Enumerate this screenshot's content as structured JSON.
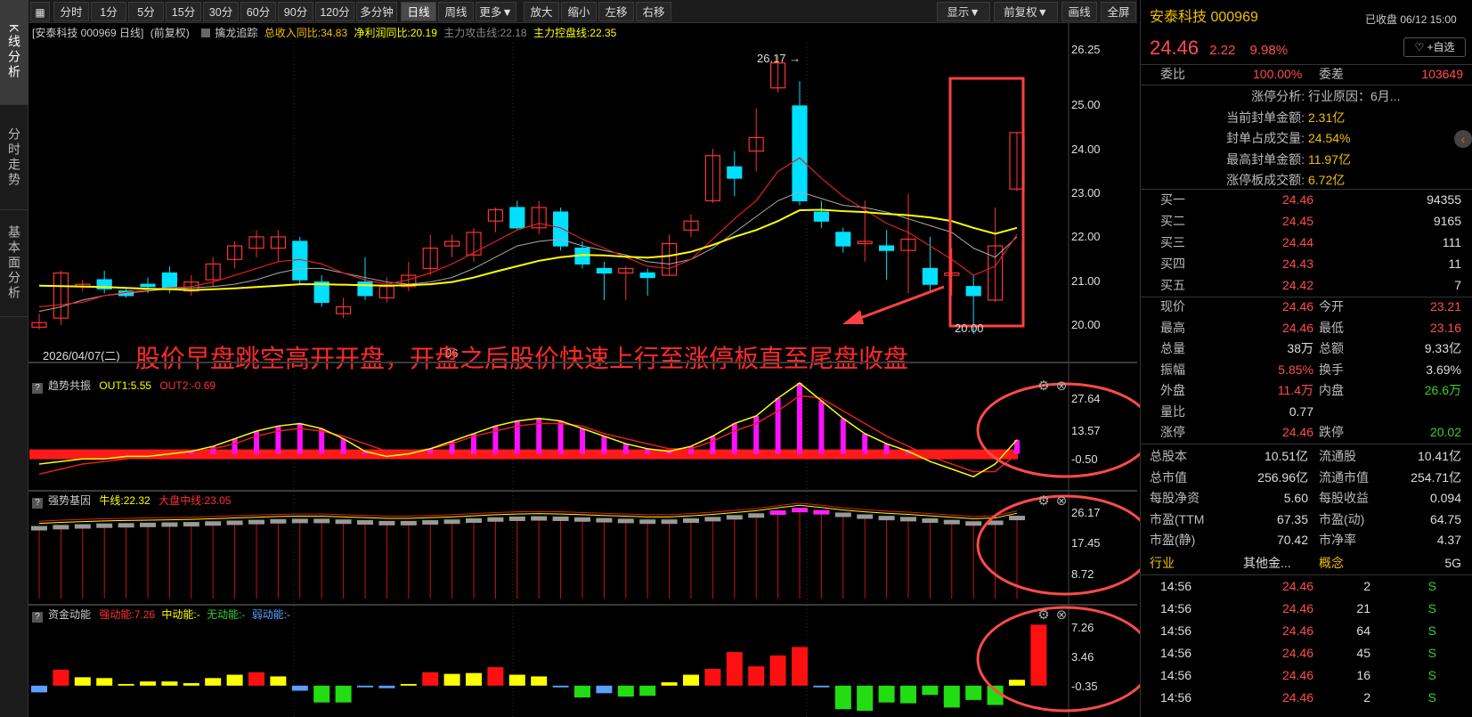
{
  "left_nav": [
    "K线分析",
    "分时走势",
    "基本面分析"
  ],
  "toolbar": {
    "periods": [
      "分时",
      "1分",
      "5分",
      "15分",
      "30分",
      "60分",
      "90分",
      "120分",
      "多分钟",
      "日线",
      "周线",
      "更多▼"
    ],
    "active_period": "日线",
    "tools": [
      "放大",
      "缩小",
      "左移",
      "右移"
    ],
    "right_tools": [
      "显示▼",
      "前复权▼",
      "画线",
      "全屏"
    ]
  },
  "infobar": {
    "stock": "[安泰科技 000969 日线]",
    "adjust": "(前复权)",
    "indicator": "擒龙追踪",
    "rev_yoy": "总收入同比:34.83",
    "profit_yoy": "净利润同比:20.19",
    "attack": "主力攻击线:22.18",
    "control": "主力控盘线:22.35"
  },
  "main_chart": {
    "axis": [
      "26.25",
      "25.00",
      "24.00",
      "23.00",
      "22.00",
      "21.00",
      "20.00"
    ],
    "high_label": "26.17",
    "low_label": "20.00",
    "date_label": "2026/04/07(二)",
    "date_tick": "06"
  },
  "annotation": "股价早盘跳空高开开盘，开盘之后股价快速上行至涨停板直至尾盘收盘",
  "panel_trend": {
    "name": "趋势共振",
    "out1": "OUT1:5.55",
    "out2": "OUT2:-0.69",
    "axis": [
      "27.64",
      "13.57",
      "-0.50"
    ]
  },
  "panel_gene": {
    "name": "强势基因",
    "bull": "牛线:22.32",
    "market": "大盘中线:23.05",
    "axis": [
      "26.17",
      "17.45",
      "8.72"
    ]
  },
  "panel_money": {
    "name": "资金动能",
    "strong": "强动能:7.26",
    "mid": "中动能:-",
    "none": "无动能:-",
    "weak": "弱动能:-",
    "axis": [
      "7.26",
      "3.46",
      "-0.35"
    ]
  },
  "quote": {
    "name": "安泰科技",
    "code": "000969",
    "status": "已收盘 06/12 15:00",
    "price": "24.46",
    "change": "2.22",
    "pct": "9.98%",
    "watch_btn": "+自选",
    "webi_label": "委比",
    "webi": "100.00%",
    "weicha_label": "委差",
    "weicha": "103649",
    "analysis": [
      {
        "k": "涨停分析:",
        "v": "行业原因：6月..."
      },
      {
        "k": "当前封单金额:",
        "v": "2.31亿"
      },
      {
        "k": "封单占成交量:",
        "v": "24.54%"
      },
      {
        "k": "最高封单金额:",
        "v": "11.97亿"
      },
      {
        "k": "涨停板成交额:",
        "v": "6.72亿"
      }
    ],
    "buys": [
      {
        "label": "买一",
        "price": "24.46",
        "vol": "94355"
      },
      {
        "label": "买二",
        "price": "24.45",
        "vol": "9165"
      },
      {
        "label": "买三",
        "price": "24.44",
        "vol": "111"
      },
      {
        "label": "买四",
        "price": "24.43",
        "vol": "11"
      },
      {
        "label": "买五",
        "price": "24.42",
        "vol": "7"
      }
    ],
    "stats": [
      {
        "k1": "现价",
        "v1": "24.46",
        "c1": "rd",
        "k2": "今开",
        "v2": "23.21",
        "c2": "rd"
      },
      {
        "k1": "最高",
        "v1": "24.46",
        "c1": "rd",
        "k2": "最低",
        "v2": "23.16",
        "c2": "rd"
      },
      {
        "k1": "总量",
        "v1": "38万",
        "c1": "wt",
        "k2": "总额",
        "v2": "9.33亿",
        "c2": "wt"
      },
      {
        "k1": "振幅",
        "v1": "5.85%",
        "c1": "rd",
        "k2": "换手",
        "v2": "3.69%",
        "c2": "wt"
      },
      {
        "k1": "外盘",
        "v1": "11.4万",
        "c1": "rd",
        "k2": "内盘",
        "v2": "26.6万",
        "c2": "gr"
      },
      {
        "k1": "量比",
        "v1": "0.77",
        "c1": "wt",
        "k2": "",
        "v2": "",
        "c2": "wt"
      },
      {
        "k1": "涨停",
        "v1": "24.46",
        "c1": "rd",
        "k2": "跌停",
        "v2": "20.02",
        "c2": "gr"
      }
    ],
    "fundamentals": [
      {
        "k1": "总股本",
        "v1": "10.51亿",
        "k2": "流通股",
        "v2": "10.41亿"
      },
      {
        "k1": "总市值",
        "v1": "256.96亿",
        "k2": "流通市值",
        "v2": "254.71亿"
      },
      {
        "k1": "每股净资",
        "v1": "5.60",
        "k2": "每股收益",
        "v2": "0.094"
      },
      {
        "k1": "市盈(TTM",
        "v1": "67.35",
        "k2": "市盈(动)",
        "v2": "64.75"
      },
      {
        "k1": "市盈(静)",
        "v1": "70.42",
        "k2": "市净率",
        "v2": "4.37"
      }
    ],
    "industry_label": "行业",
    "industry": "其他金...",
    "concept_label": "概念",
    "concept": "5G",
    "ticks": [
      {
        "t": "14:56",
        "p": "24.46",
        "v": "2",
        "s": "S"
      },
      {
        "t": "14:56",
        "p": "24.46",
        "v": "21",
        "s": "S"
      },
      {
        "t": "14:56",
        "p": "24.46",
        "v": "64",
        "s": "S"
      },
      {
        "t": "14:56",
        "p": "24.46",
        "v": "45",
        "s": "S"
      },
      {
        "t": "14:56",
        "p": "24.46",
        "v": "16",
        "s": "S"
      },
      {
        "t": "14:56",
        "p": "24.46",
        "v": "2",
        "s": "S"
      }
    ]
  },
  "colors": {
    "up": "#ff3232",
    "down": "#00e0ff",
    "ma_yellow": "#ffff00",
    "ma_gray": "#aaaaaa",
    "annotation": "#ff2a2a"
  },
  "candles": [
    [
      20.15,
      20.25,
      20.45,
      20.1
    ],
    [
      20.35,
      21.35,
      21.4,
      20.2
    ],
    [
      21.05,
      21.1,
      21.2,
      20.95
    ],
    [
      21.2,
      21.0,
      21.4,
      20.9
    ],
    [
      20.95,
      20.85,
      21.0,
      20.8
    ],
    [
      21.1,
      21.05,
      21.25,
      20.9
    ],
    [
      21.35,
      21.0,
      21.5,
      20.9
    ],
    [
      20.95,
      21.15,
      21.3,
      20.85
    ],
    [
      21.2,
      21.55,
      21.7,
      21.05
    ],
    [
      21.65,
      21.95,
      22.05,
      21.45
    ],
    [
      21.9,
      22.15,
      22.3,
      21.7
    ],
    [
      21.9,
      22.15,
      22.3,
      21.6
    ],
    [
      22.05,
      21.2,
      22.15,
      21.1
    ],
    [
      21.15,
      20.7,
      21.3,
      20.6
    ],
    [
      20.45,
      20.6,
      20.8,
      20.35
    ],
    [
      21.15,
      20.85,
      21.7,
      20.75
    ],
    [
      20.8,
      21.05,
      21.25,
      20.7
    ],
    [
      21.05,
      21.3,
      21.6,
      20.95
    ],
    [
      21.45,
      21.9,
      22.2,
      21.3
    ],
    [
      21.95,
      22.05,
      22.2,
      21.7
    ],
    [
      21.75,
      22.25,
      22.35,
      21.6
    ],
    [
      22.5,
      22.75,
      22.8,
      22.25
    ],
    [
      22.8,
      22.35,
      22.95,
      22.3
    ],
    [
      22.35,
      22.8,
      22.95,
      22.2
    ],
    [
      22.7,
      21.95,
      22.8,
      21.85
    ],
    [
      21.9,
      21.55,
      22.05,
      21.45
    ],
    [
      21.45,
      21.35,
      21.6,
      20.75
    ],
    [
      21.35,
      21.45,
      21.5,
      20.75
    ],
    [
      21.35,
      21.25,
      21.45,
      20.85
    ],
    [
      21.3,
      22.0,
      22.2,
      21.3
    ],
    [
      22.3,
      22.5,
      22.65,
      22.15
    ],
    [
      22.95,
      23.95,
      24.1,
      22.9
    ],
    [
      23.7,
      23.45,
      24.05,
      23.05
    ],
    [
      24.05,
      24.35,
      25.0,
      23.6
    ],
    [
      25.45,
      26.0,
      26.17,
      25.35
    ],
    [
      25.05,
      22.95,
      25.6,
      22.85
    ],
    [
      22.7,
      22.5,
      22.95,
      22.35
    ],
    [
      22.25,
      21.95,
      22.35,
      21.8
    ],
    [
      22.0,
      22.05,
      22.95,
      21.6
    ],
    [
      21.95,
      21.85,
      22.3,
      21.2
    ],
    [
      21.85,
      22.1,
      23.1,
      20.9
    ],
    [
      21.45,
      21.1,
      22.15,
      20.95
    ],
    [
      21.3,
      21.35,
      21.9,
      20.85
    ],
    [
      21.05,
      20.85,
      21.3,
      20.0
    ],
    [
      20.75,
      21.95,
      22.8,
      20.7
    ],
    [
      23.21,
      24.46,
      24.46,
      23.16
    ]
  ],
  "ma_yellow": [
    21.07,
    21.06,
    21.05,
    21.04,
    21.02,
    21.0,
    20.99,
    20.97,
    20.99,
    21.01,
    21.04,
    21.07,
    21.1,
    21.1,
    21.09,
    21.08,
    21.07,
    21.08,
    21.1,
    21.15,
    21.25,
    21.38,
    21.5,
    21.62,
    21.7,
    21.75,
    21.74,
    21.71,
    21.69,
    21.73,
    21.82,
    21.97,
    22.15,
    22.3,
    22.5,
    22.74,
    22.75,
    22.72,
    22.7,
    22.66,
    22.63,
    22.58,
    22.5,
    22.35,
    22.22,
    22.35
  ],
  "ma_gray": [
    20.5,
    20.6,
    20.75,
    20.85,
    20.9,
    20.95,
    21.0,
    21.02,
    21.05,
    21.1,
    21.2,
    21.35,
    21.45,
    21.45,
    21.35,
    21.25,
    21.15,
    21.1,
    21.15,
    21.25,
    21.45,
    21.7,
    21.95,
    22.05,
    22.1,
    21.95,
    21.85,
    21.75,
    21.6,
    21.55,
    21.65,
    21.9,
    22.25,
    22.6,
    22.95,
    23.15,
    23.0,
    22.85,
    22.8,
    22.7,
    22.55,
    22.4,
    22.25,
    21.9,
    21.7,
    22.15
  ],
  "ma_red": [
    20.6,
    20.65,
    20.7,
    20.85,
    20.92,
    20.98,
    21.02,
    21.05,
    21.15,
    21.3,
    21.45,
    21.6,
    21.65,
    21.55,
    21.35,
    21.2,
    21.1,
    21.2,
    21.35,
    21.55,
    21.8,
    22.05,
    22.3,
    22.45,
    22.35,
    22.1,
    21.9,
    21.7,
    21.5,
    21.45,
    21.65,
    22.1,
    22.55,
    22.95,
    23.6,
    23.9,
    23.45,
    23.05,
    22.75,
    22.45,
    22.25,
    21.95,
    21.65,
    21.3,
    21.5,
    22.2
  ],
  "trend_values": [
    -4,
    -3,
    -2,
    -2,
    -1,
    -1,
    0,
    1,
    3,
    6,
    9,
    11,
    12,
    10,
    6,
    1,
    -1,
    0,
    2,
    5,
    8,
    11,
    13,
    14,
    13,
    10,
    7,
    4,
    2,
    1,
    3,
    7,
    12,
    15,
    22,
    28,
    21,
    14,
    8,
    4,
    1,
    -3,
    -6,
    -9,
    -4,
    5.55
  ],
  "trend_line2": [
    -8,
    -6,
    -4,
    -3,
    -2,
    -1,
    0,
    1,
    2,
    4,
    7,
    9,
    10,
    9,
    7,
    4,
    1,
    1,
    2,
    4,
    7,
    9,
    11,
    12,
    12,
    11,
    8,
    6,
    4,
    2,
    2,
    5,
    9,
    12,
    17,
    23,
    22,
    17,
    12,
    7,
    3,
    -1,
    -4,
    -7,
    -7,
    0
  ],
  "gene_values": [
    19.5,
    19.8,
    20,
    20.2,
    20.3,
    20.4,
    20.5,
    20.6,
    20.8,
    21.0,
    21.2,
    21.4,
    21.5,
    21.5,
    21.3,
    21.1,
    20.9,
    20.9,
    21.1,
    21.3,
    21.6,
    21.9,
    22.1,
    22.2,
    22.1,
    21.9,
    21.7,
    21.5,
    21.3,
    21.3,
    21.6,
    22.0,
    22.5,
    23.0,
    23.8,
    24.5,
    23.9,
    23.2,
    22.7,
    22.3,
    22.0,
    21.6,
    21.2,
    20.8,
    21.0,
    22.32
  ],
  "money_values": [
    -0.8,
    1.9,
    1.0,
    0.9,
    0.2,
    0.5,
    0.5,
    0.3,
    0.9,
    1.3,
    1.6,
    1.1,
    -0.6,
    -2.0,
    -2.0,
    -0.2,
    -0.3,
    0.2,
    1.6,
    1.4,
    1.5,
    2.2,
    1.3,
    1.1,
    -0.2,
    -1.4,
    -0.9,
    -1.3,
    -1.2,
    0.4,
    1.3,
    2.0,
    4.0,
    2.3,
    3.6,
    4.6,
    -0.2,
    -2.8,
    -3.0,
    -2.0,
    -2.1,
    -1.1,
    -2.6,
    -1.7,
    -2.3,
    0.7,
    7.26
  ]
}
